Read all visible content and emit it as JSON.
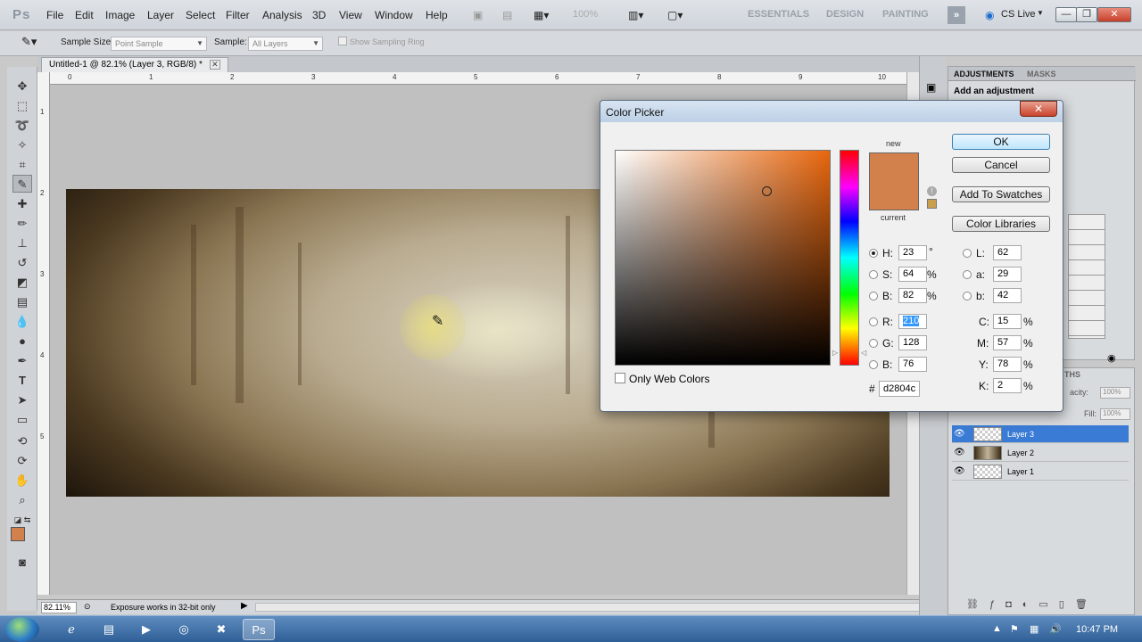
{
  "app": {
    "logo": "Ps"
  },
  "menu": [
    "File",
    "Edit",
    "Image",
    "Layer",
    "Select",
    "Filter",
    "Analysis",
    "3D",
    "View",
    "Window",
    "Help"
  ],
  "zoom_display": "100%",
  "workspaces": [
    "ESSENTIALS",
    "DESIGN",
    "PAINTING"
  ],
  "cs_live": "CS Live",
  "window_controls": {
    "minimize": "—",
    "restore": "❐",
    "close": "✕"
  },
  "options": {
    "sample_size_label": "Sample Size:",
    "sample_size_value": "Point Sample",
    "sample_label": "Sample:",
    "sample_value": "All Layers",
    "show_ring_label": "Show Sampling Ring"
  },
  "document": {
    "tab_title": "Untitled-1 @ 82.1% (Layer 3, RGB/8) *",
    "ruler_h": [
      "0",
      "1",
      "2",
      "3",
      "4",
      "5",
      "6",
      "7",
      "8",
      "9",
      "10"
    ],
    "ruler_v": [
      "1",
      "2",
      "3",
      "4",
      "5"
    ]
  },
  "status": {
    "zoom": "82.11%",
    "message": "Exposure works in 32-bit only"
  },
  "adjustments": {
    "tabs": [
      "ADJUSTMENTS",
      "MASKS"
    ],
    "title": "Add an adjustment"
  },
  "layers_panel": {
    "tab_fragment": "THS",
    "opacity_label": "acity:",
    "opacity_value": "100%",
    "fill_label": "Fill:",
    "fill_value": "100%",
    "layers": [
      {
        "name": "Layer 3",
        "selected": true
      },
      {
        "name": "Layer 2",
        "selected": false
      },
      {
        "name": "Layer 1",
        "selected": false
      }
    ]
  },
  "color_picker": {
    "title": "Color Picker",
    "close": "✕",
    "new_label": "new",
    "current_label": "current",
    "buttons": {
      "ok": "OK",
      "cancel": "Cancel",
      "add_swatches": "Add To Swatches",
      "color_libraries": "Color Libraries"
    },
    "hsb": {
      "H": "23",
      "S": "64",
      "B": "82"
    },
    "rgb": {
      "R": "210",
      "G": "128",
      "B": "76"
    },
    "lab": {
      "L": "62",
      "a": "29",
      "b": "42"
    },
    "cmyk": {
      "C": "15",
      "M": "57",
      "Y": "78",
      "K": "2"
    },
    "units": {
      "deg": "°",
      "pct": "%"
    },
    "hex_label": "#",
    "hex": "d2804c",
    "web_colors_label": "Only Web Colors",
    "selected_color": "#d2804c"
  },
  "taskbar": {
    "time": "10:47 PM"
  }
}
